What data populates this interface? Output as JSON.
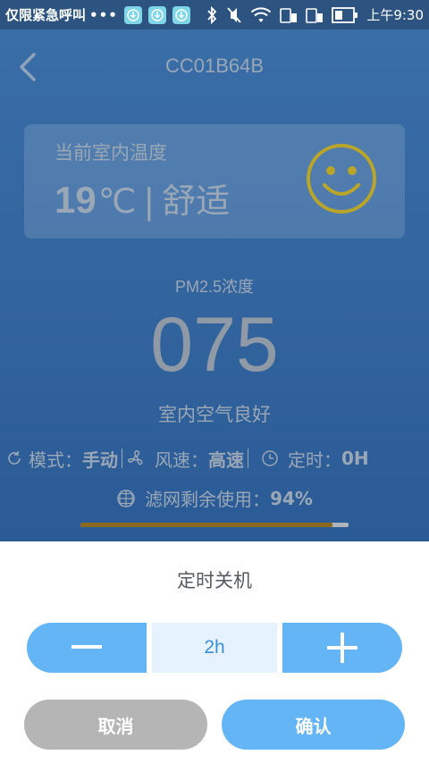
{
  "status_bar": {
    "carrier": "仅限紧急呼叫",
    "overflow": "•••",
    "time": "上午9:30"
  },
  "header": {
    "device_id": "CC01B64B"
  },
  "temperature_card": {
    "label": "当前室内温度",
    "value": "19",
    "unit": "℃",
    "separator": "|",
    "comfort": "舒适"
  },
  "pm25": {
    "label": "PM2.5浓度",
    "value": "075",
    "quality": "室内空气良好"
  },
  "status_row": {
    "mode_label": "模式：",
    "mode_value": "手动",
    "speed_label": "风速：",
    "speed_value": "高速",
    "timer_label": "定时：",
    "timer_value": "0H"
  },
  "filter": {
    "label": "滤网剩余使用：",
    "value": "94%",
    "remaining_fraction": 0.94
  },
  "timer_sheet": {
    "title": "定时关机",
    "value": "2h",
    "cancel_label": "取消",
    "confirm_label": "确认"
  },
  "colors": {
    "accent": "#63b5f5",
    "smile": "#b8a52a",
    "filter_fill": "#8b6a1e"
  }
}
